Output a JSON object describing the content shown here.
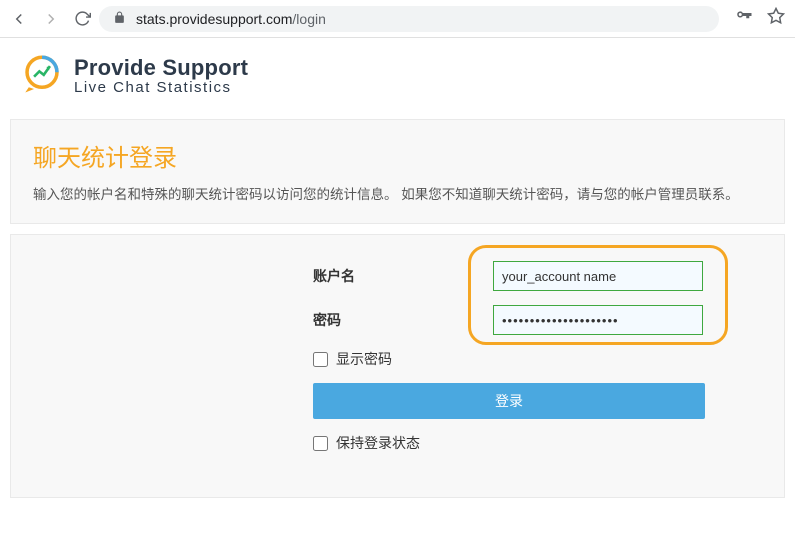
{
  "browser": {
    "url_host": "stats.providesupport.com",
    "url_path": "/login"
  },
  "brand": {
    "title": "Provide Support",
    "subtitle": "Live Chat Statistics"
  },
  "intro": {
    "title": "聊天统计登录",
    "desc": "输入您的帐户名和特殊的聊天统计密码以访问您的统计信息。 如果您不知道聊天统计密码，请与您的帐户管理员联系。"
  },
  "form": {
    "account_label": "账户名",
    "account_value": "your_account name",
    "password_label": "密码",
    "password_value": "•••••••••••••••••••••",
    "show_password_label": "显示密码",
    "login_button": "登录",
    "keep_logged_label": "保持登录状态"
  }
}
